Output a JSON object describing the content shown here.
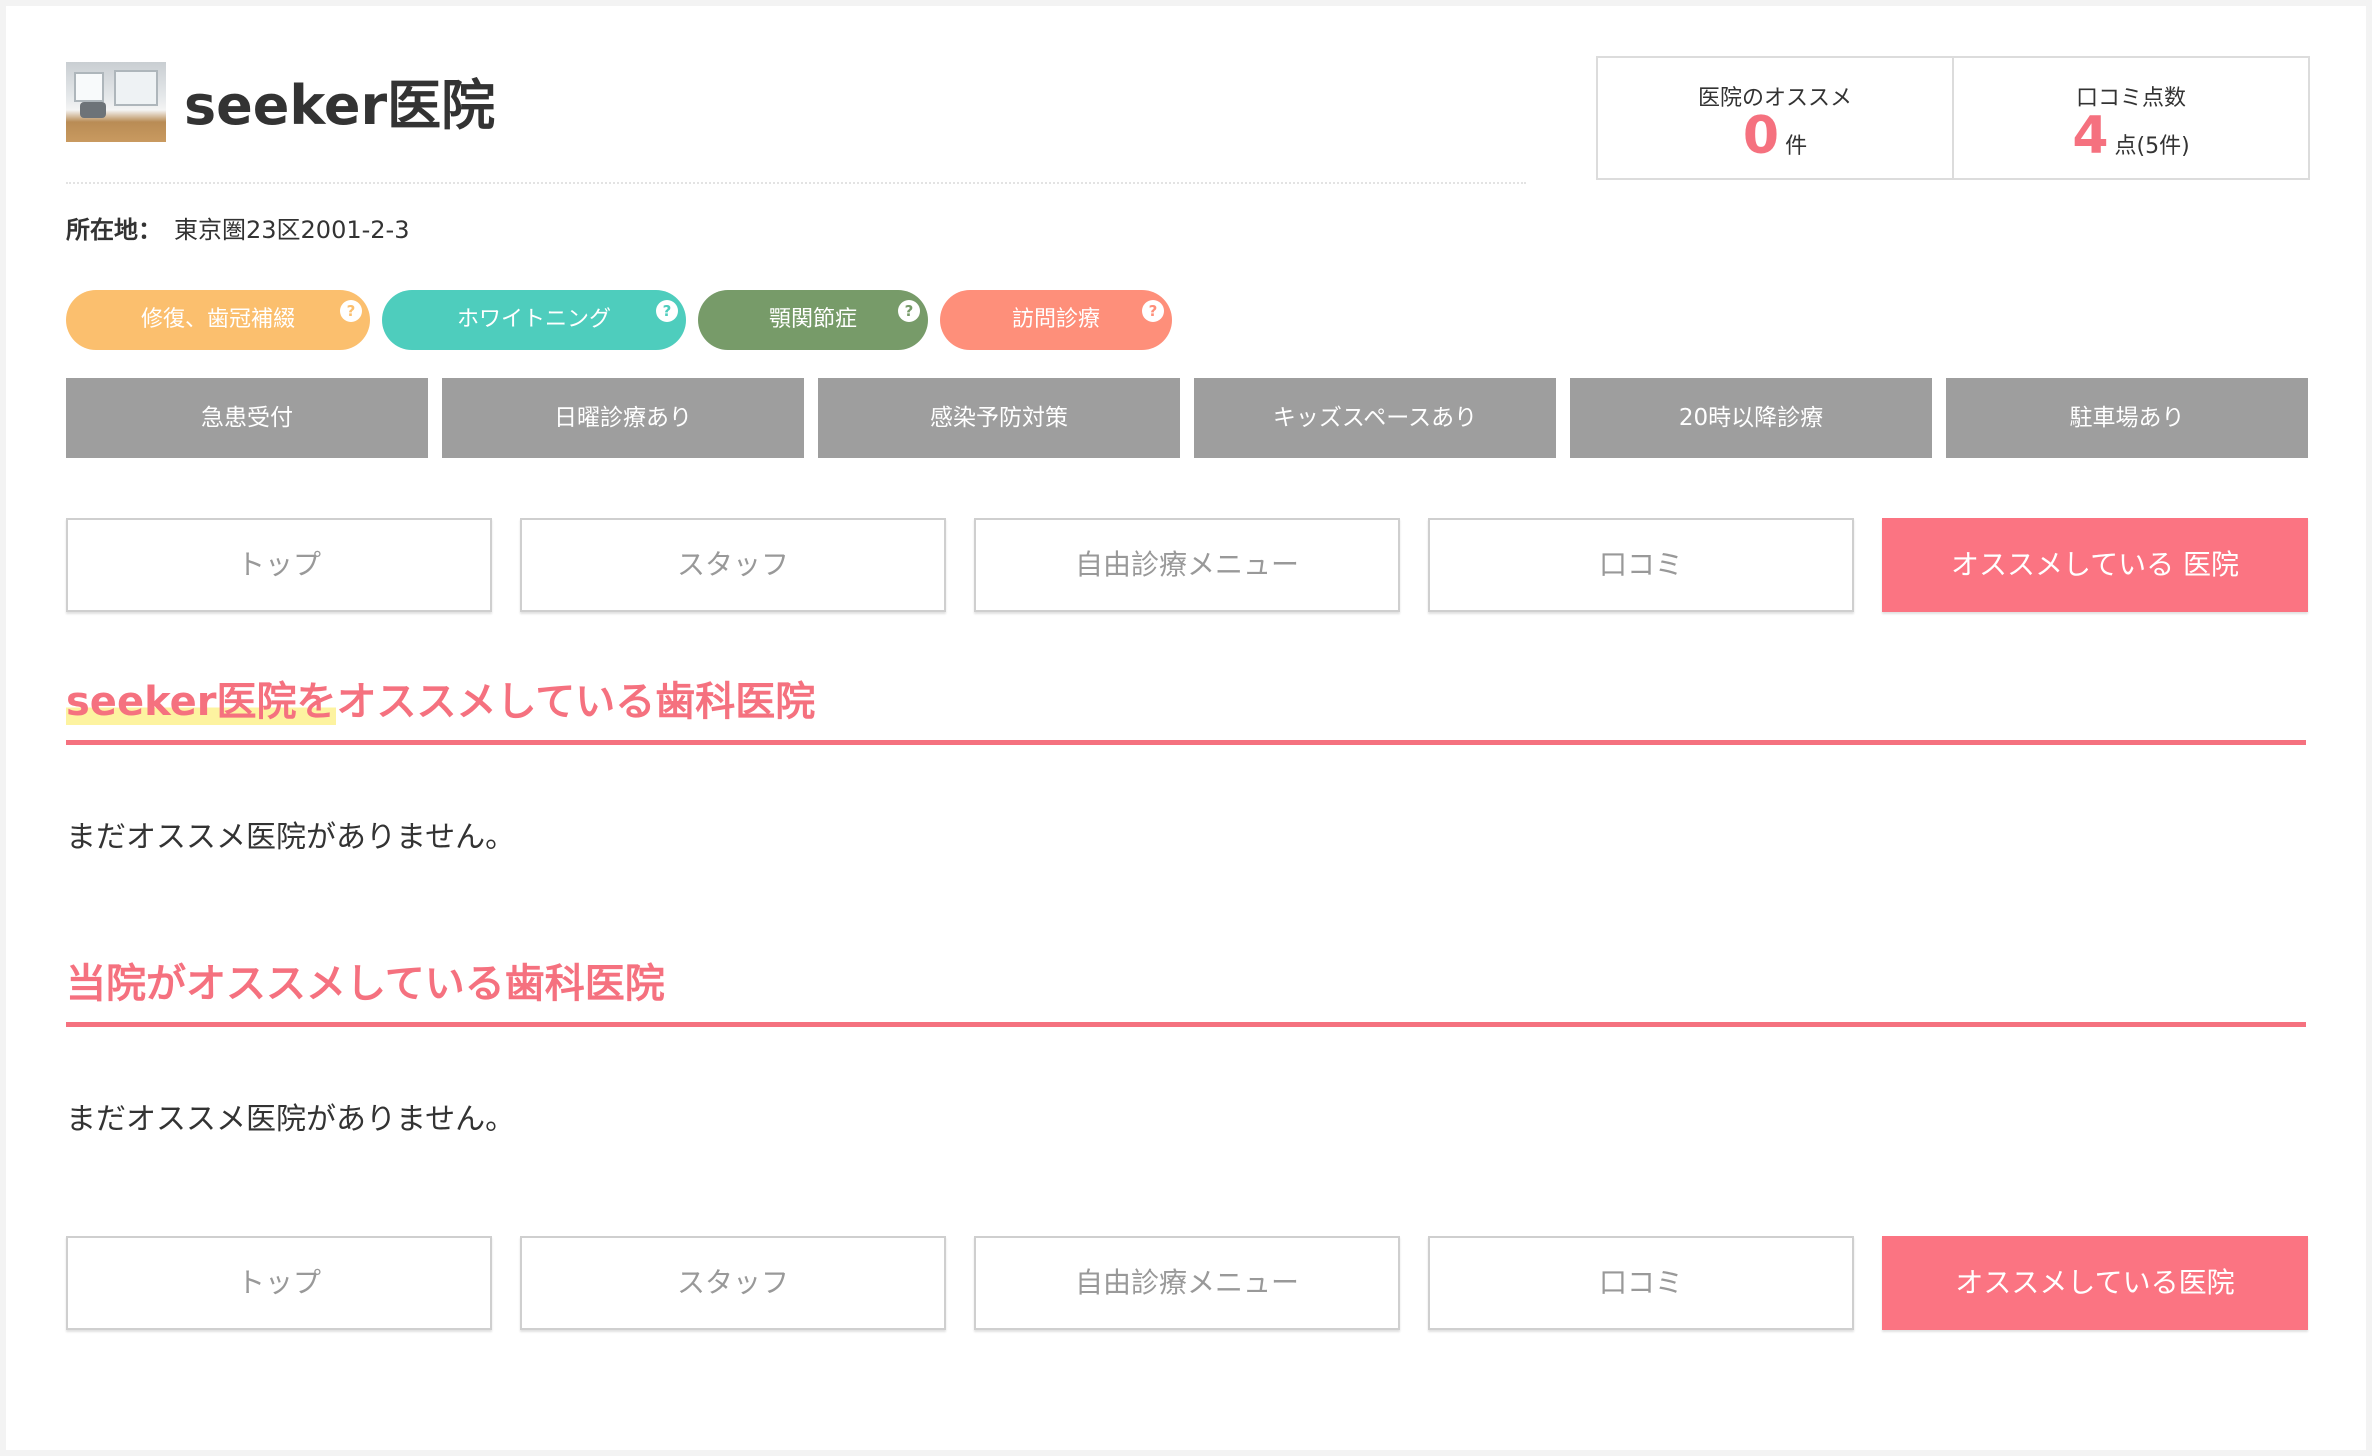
{
  "clinic": {
    "name": "seeker医院",
    "address_label": "所在地：",
    "address": "東京圏23区2001-2-3"
  },
  "stats": [
    {
      "label": "医院のオススメ",
      "value": "0",
      "unit": "件"
    },
    {
      "label": "口コミ点数",
      "value": "4",
      "unit": "点(5件)"
    }
  ],
  "tags": [
    {
      "label": "修復、歯冠補綴",
      "color": "#fbbf6e",
      "help": "?"
    },
    {
      "label": "ホワイトニング",
      "color": "#4ecdbd",
      "help": "?"
    },
    {
      "label": "顎関節症",
      "color": "#779b69",
      "help": "?"
    },
    {
      "label": "訪問診療",
      "color": "#fe8f7a",
      "help": "?"
    }
  ],
  "features": [
    "急患受付",
    "日曜診療あり",
    "感染予防対策",
    "キッズスペースあり",
    "20時以降診療",
    "駐車場あり"
  ],
  "nav_top": [
    "トップ",
    "スタッフ",
    "自由診療メニュー",
    "口コミ",
    "オススメしている 医院"
  ],
  "nav_bottom": [
    "トップ",
    "スタッフ",
    "自由診療メニュー",
    "口コミ",
    "オススメしている医院"
  ],
  "sections": {
    "recommended_by": {
      "title_highlight": "seeker医院を",
      "title_rest": "オススメしている歯科医院",
      "empty": "まだオススメ医院がありません。"
    },
    "we_recommend": {
      "title": "当院がオススメしている歯科医院",
      "empty": "まだオススメ医院がありません。"
    }
  },
  "colors": {
    "accent": "#f5717f",
    "nav_active": "#fb7482",
    "feature_bg": "#9e9e9e",
    "highlight": "#fdf3a0"
  }
}
